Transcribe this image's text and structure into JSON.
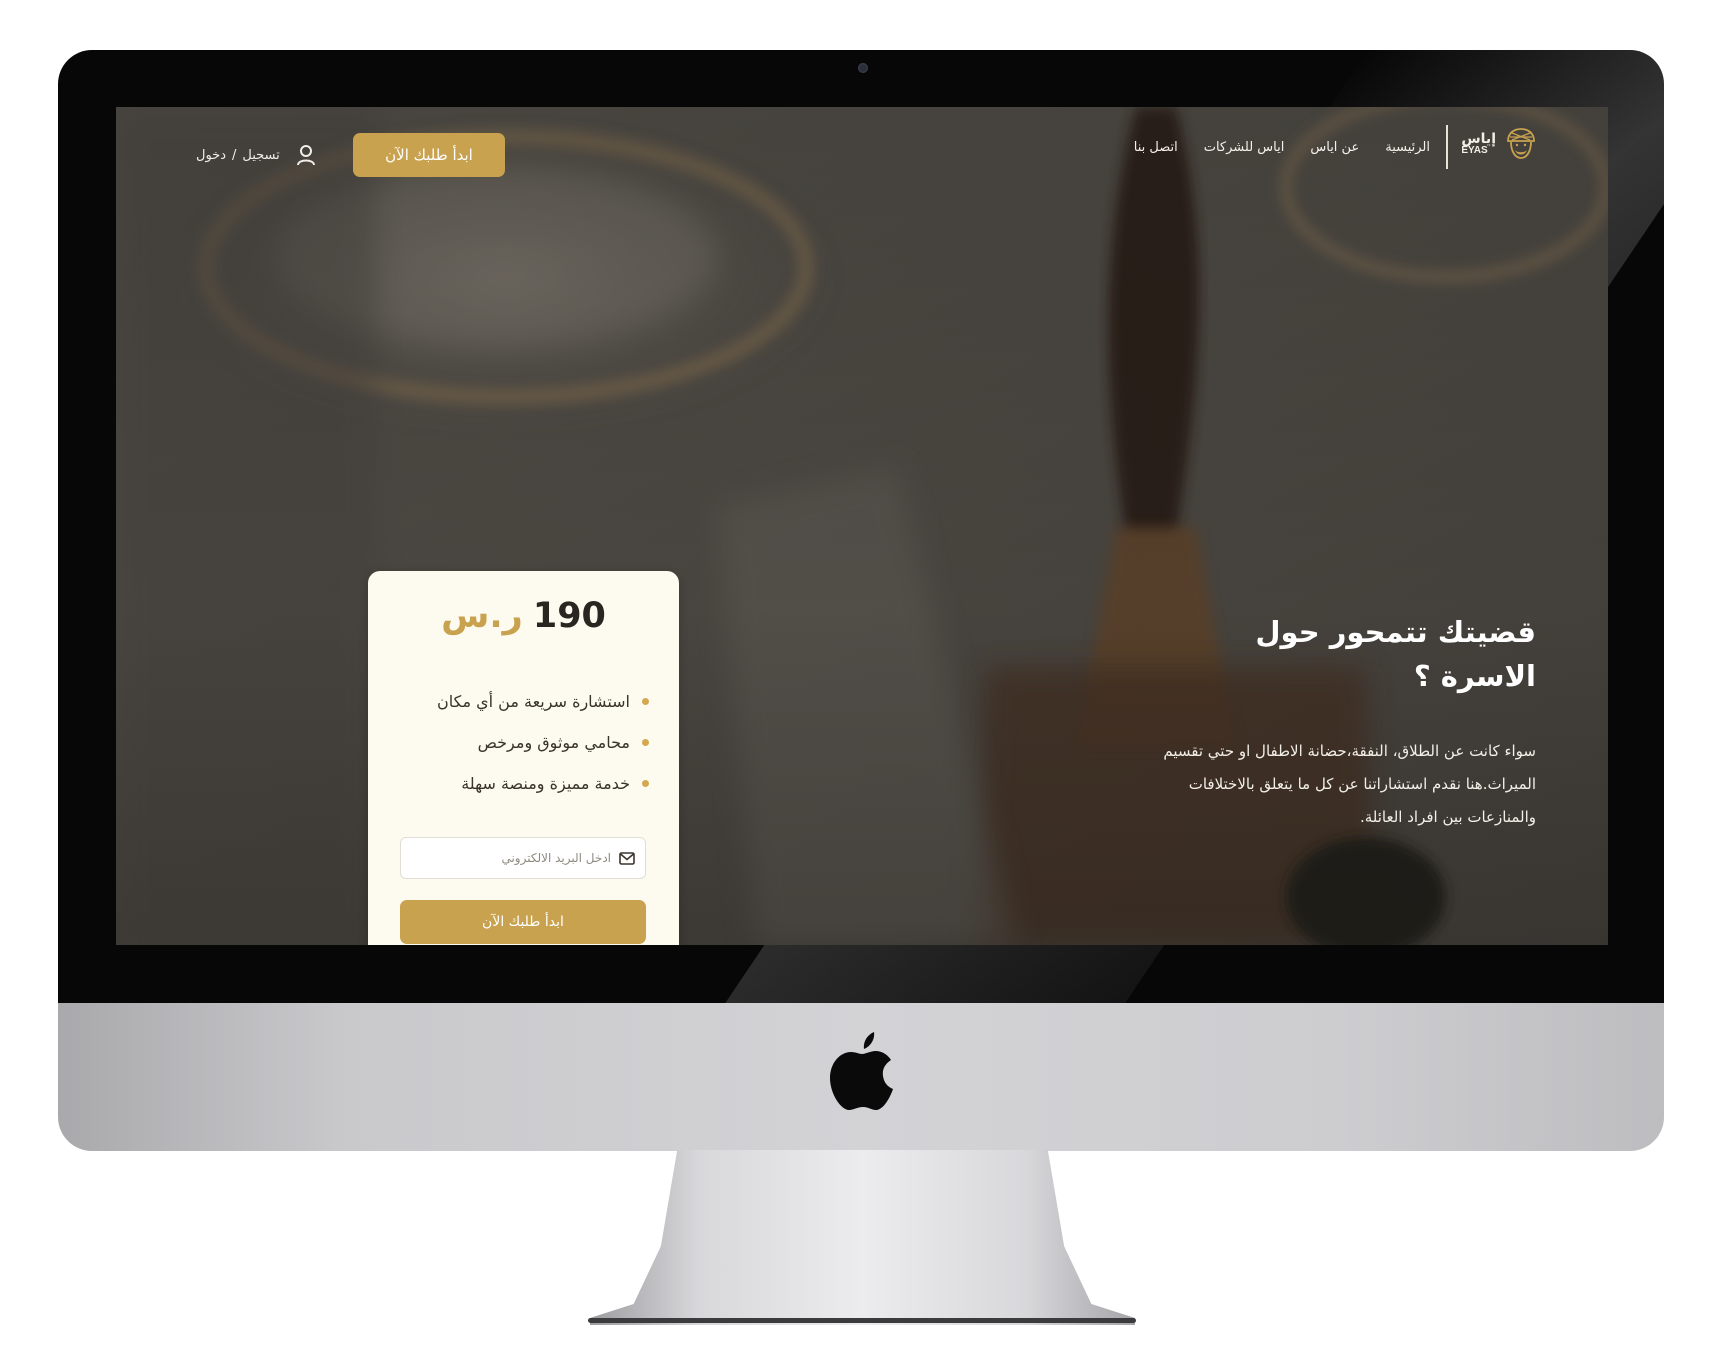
{
  "brand": {
    "name_ar": "إياس",
    "name_en": "EYAS",
    "emblem_icon": "turban-man-icon",
    "accent_color": "#c9a24f"
  },
  "nav": {
    "items": [
      {
        "label": "الرئيسية"
      },
      {
        "label": "عن اياس"
      },
      {
        "label": "اياس للشركات"
      },
      {
        "label": "اتصل بنا"
      }
    ],
    "cta_label": "ابدأ طلبك الآن",
    "register_label": "تسجيل",
    "separator": "/",
    "login_label": "دخول",
    "user_icon": "user-icon"
  },
  "hero": {
    "title": "قضيتك تتمحور حول الاسرة ؟",
    "description": "سواء كانت عن الطلاق، النفقة،حضانة الاطفال او حتي تقسيم الميراث.هنا نقدم استشاراتنا عن كل ما يتعلق بالاختلافات والمنازعات بين افراد العائلة."
  },
  "pricing": {
    "amount": "190",
    "currency": "ر.س",
    "features": [
      "استشارة سريعة من أي مكان",
      "محامي موثوق ومرخص",
      "خدمة مميزة ومنصة سهلة"
    ],
    "email_placeholder": "ادخل البريد الالكتروني",
    "email_value": "",
    "mail_icon": "envelope-icon",
    "cta_label": "ابدأ طلبك الآن"
  },
  "device": {
    "logo_icon": "apple-logo-icon"
  }
}
